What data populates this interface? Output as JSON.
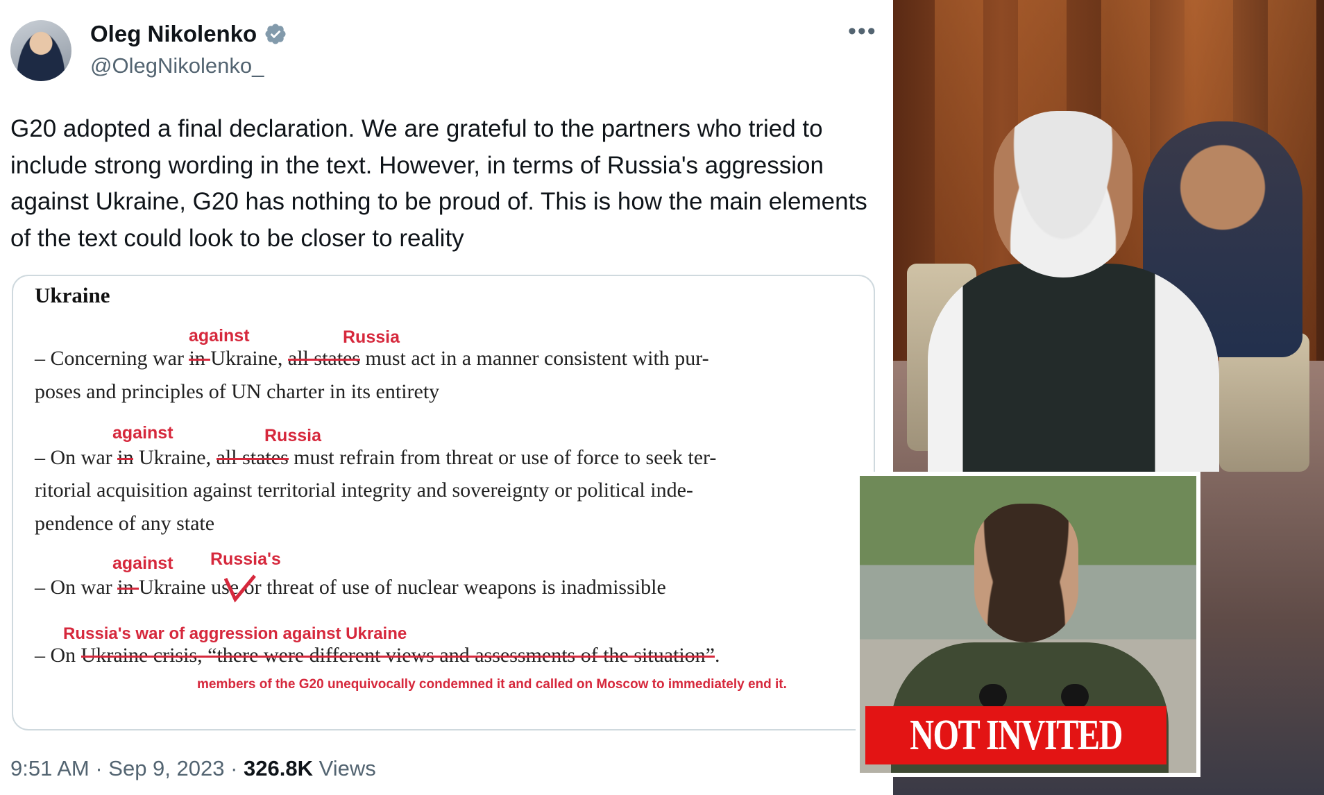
{
  "tweet": {
    "display_name": "Oleg Nikolenko",
    "handle": "@OlegNikolenko_",
    "more": "•••",
    "text": "G20 adopted a final declaration. We are grateful to the partners who tried to include strong wording in the text. However, in terms of Russia's aggression against Ukraine, G20 has nothing to be proud of. This is how the main elements of the text could look to be closer to reality",
    "timestamp": "9:51 AM · Sep 9, 2023 · ",
    "views_count": "326.8K",
    "views_label": " Views"
  },
  "card": {
    "title": "Ukraine",
    "p1": {
      "prefix": "– Concerning war ",
      "struck1": "in ",
      "mid": "Ukraine, ",
      "struck2": "all states",
      "suffix": " must act in a manner consistent with pur-",
      "line2": "poses and principles of UN charter in its entirety",
      "insert1": "against",
      "insert2": "Russia"
    },
    "p2": {
      "prefix": "– On war ",
      "struck1": "in",
      "mid": " Ukraine, ",
      "struck2": "all states",
      "suffix": " must refrain from threat or use of force to seek ter-",
      "line2": "ritorial acquisition against territorial integrity and sovereignty or political inde-",
      "line3": "pendence of any state",
      "insert1": "against",
      "insert2": "Russia"
    },
    "p3": {
      "prefix": "– On war ",
      "struck1": "in ",
      "mid": "Ukraine ",
      "suffix": "use or threat of use of nuclear weapons is inadmissible",
      "insert1": "against",
      "insert2": "Russia's"
    },
    "p4": {
      "prefix": "– On ",
      "struck1": "Ukraine crisis,",
      "struck2": " “there were different views and assessments of the situation”",
      "suffix": ".",
      "insert1": "Russia's war of aggression against Ukraine",
      "insert2": "members of the G20 unequivocally condemned it and called on Moscow to immediately end it."
    }
  },
  "inset": {
    "banner": "NOT INVITED"
  },
  "colors": {
    "annotation_red": "#d6283c",
    "banner_red": "#e31414",
    "verified_blue": "#1d9bf0"
  },
  "icons": [
    "verified-badge-icon",
    "more-options-icon"
  ]
}
